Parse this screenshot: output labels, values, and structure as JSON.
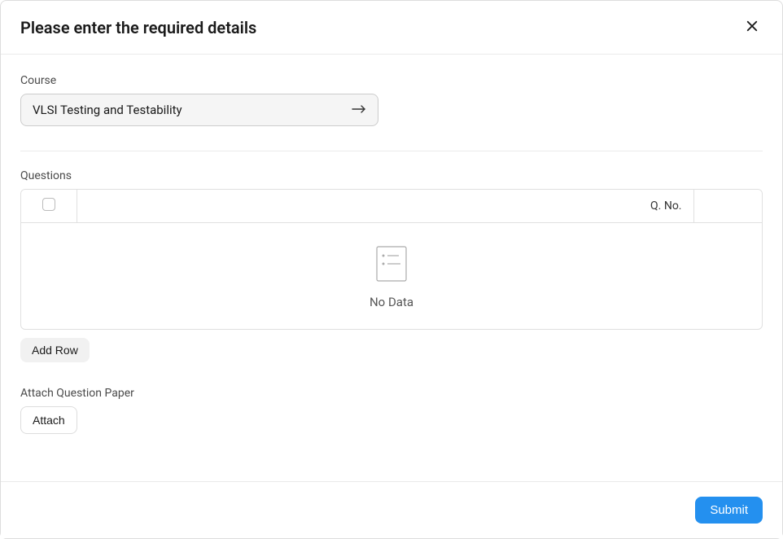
{
  "header": {
    "title": "Please enter the required details"
  },
  "course": {
    "label": "Course",
    "value": "VLSI Testing and Testability"
  },
  "questions": {
    "label": "Questions",
    "column_header": "Q. No.",
    "no_data_text": "No Data",
    "add_row_label": "Add Row"
  },
  "attachment": {
    "label": "Attach Question Paper",
    "button_label": "Attach"
  },
  "footer": {
    "submit_label": "Submit"
  }
}
